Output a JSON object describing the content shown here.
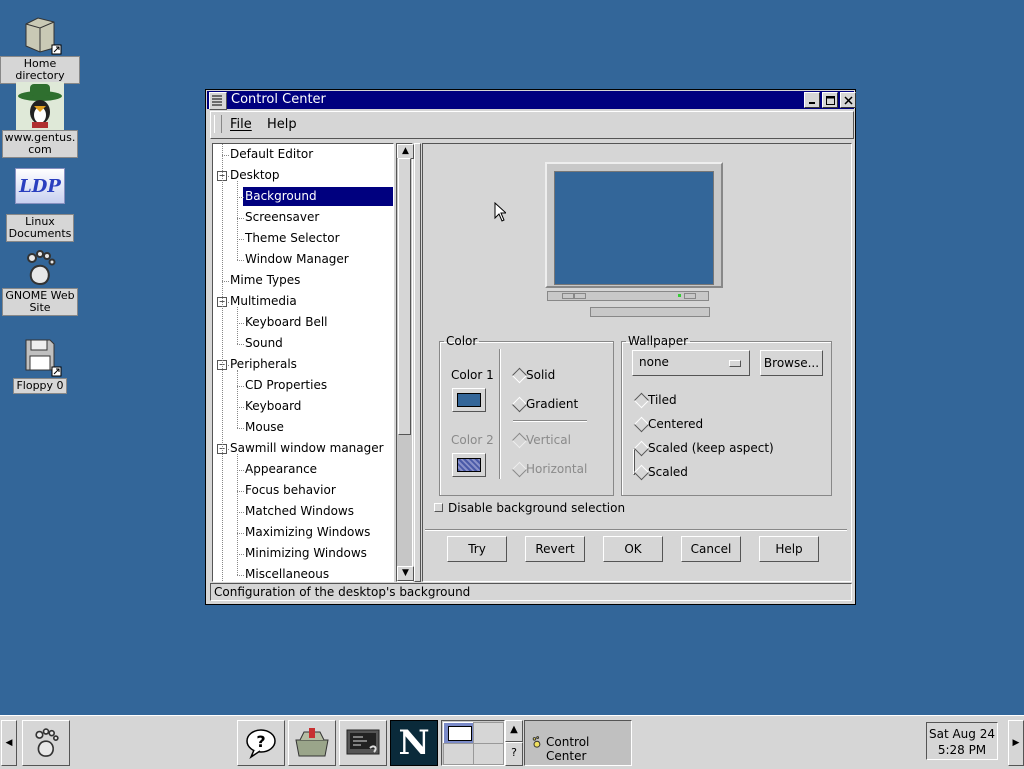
{
  "desktop": {
    "icons": [
      {
        "label": "Home directory",
        "icon": "folder-link-icon"
      },
      {
        "label": "www.gentus.\ncom",
        "icon": "gentoo-cowboy-icon"
      },
      {
        "label": "Linux\nDocuments",
        "icon": "ldp-icon",
        "logo_text": "LDP"
      },
      {
        "label": "GNOME Web\nSite",
        "icon": "gnome-foot-icon"
      },
      {
        "label": "Floppy 0",
        "icon": "floppy-icon"
      }
    ]
  },
  "window": {
    "title": "Control Center",
    "menu": {
      "file": "File",
      "help": "Help"
    },
    "tree": [
      {
        "label": "Default Editor",
        "level": 0
      },
      {
        "label": "Desktop",
        "level": 0,
        "expanded": true
      },
      {
        "label": "Background",
        "level": 1,
        "selected": true
      },
      {
        "label": "Screensaver",
        "level": 1
      },
      {
        "label": "Theme Selector",
        "level": 1
      },
      {
        "label": "Window Manager",
        "level": 1
      },
      {
        "label": "Mime Types",
        "level": 0
      },
      {
        "label": "Multimedia",
        "level": 0,
        "expanded": true
      },
      {
        "label": "Keyboard Bell",
        "level": 1
      },
      {
        "label": "Sound",
        "level": 1
      },
      {
        "label": "Peripherals",
        "level": 0,
        "expanded": true
      },
      {
        "label": "CD Properties",
        "level": 1
      },
      {
        "label": "Keyboard",
        "level": 1
      },
      {
        "label": "Mouse",
        "level": 1
      },
      {
        "label": "Sawmill window manager",
        "level": 0,
        "expanded": true
      },
      {
        "label": "Appearance",
        "level": 1
      },
      {
        "label": "Focus behavior",
        "level": 1
      },
      {
        "label": "Matched Windows",
        "level": 1
      },
      {
        "label": "Maximizing Windows",
        "level": 1
      },
      {
        "label": "Minimizing Windows",
        "level": 1
      },
      {
        "label": "Miscellaneous",
        "level": 1
      }
    ],
    "background": {
      "preview_color": "#336699",
      "color_group": {
        "legend": "Color",
        "color1_label": "Color 1",
        "color1_value": "#336699",
        "color2_label": "Color 2",
        "color2_value": "#4a5aa8",
        "solid": "Solid",
        "gradient": "Gradient",
        "vertical": "Vertical",
        "horizontal": "Horizontal",
        "selected": "Solid"
      },
      "wallpaper_group": {
        "legend": "Wallpaper",
        "file": "none",
        "browse": "Browse...",
        "tiled": "Tiled",
        "centered": "Centered",
        "scaled_keep": "Scaled (keep aspect)",
        "scaled": "Scaled",
        "selected": "Tiled"
      },
      "disable_label": "Disable background selection",
      "disable_checked": false
    },
    "buttons": {
      "try": "Try",
      "revert": "Revert",
      "ok": "OK",
      "cancel": "Cancel",
      "help": "Help"
    },
    "status": "Configuration of the desktop's background"
  },
  "taskbar": {
    "task_label": "Control Center",
    "pager_help": "?",
    "clock_date": "Sat Aug 24",
    "clock_time": "5:28 PM",
    "netscape_letter": "N"
  }
}
